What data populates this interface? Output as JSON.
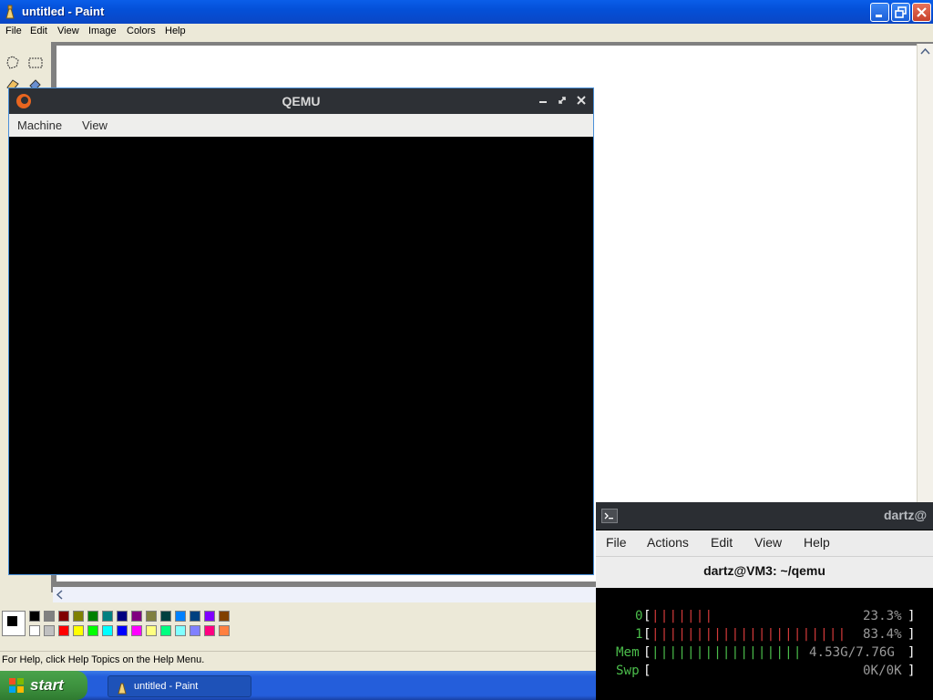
{
  "paint": {
    "title": "untitled - Paint",
    "menu": [
      "File",
      "Edit",
      "View",
      "Image",
      "Colors",
      "Help"
    ],
    "status": "For Help, click Help Topics on the Help Menu.",
    "palette_top": [
      "#000000",
      "#808080",
      "#800000",
      "#808000",
      "#008000",
      "#008080",
      "#000080",
      "#800080",
      "#808040",
      "#004040",
      "#0080ff",
      "#004080",
      "#8000ff",
      "#804000"
    ],
    "palette_bottom": [
      "#ffffff",
      "#c0c0c0",
      "#ff0000",
      "#ffff00",
      "#00ff00",
      "#00ffff",
      "#0000ff",
      "#ff00ff",
      "#ffff80",
      "#00ff80",
      "#80ffff",
      "#8080ff",
      "#ff0080",
      "#ff8040"
    ]
  },
  "taskbar": {
    "start_label": "start",
    "task_label": "untitled - Paint"
  },
  "qemu": {
    "title": "QEMU",
    "menu": [
      "Machine",
      "View"
    ]
  },
  "terminal": {
    "title": "dartz@",
    "menu": [
      "File",
      "Actions",
      "Edit",
      "View",
      "Help"
    ],
    "tab_title": "dartz@VM3: ~/qemu",
    "htop": {
      "cpu0_label": "0",
      "cpu0_bars": "|||||||",
      "cpu0_value": "23.3%",
      "cpu1_label": "1",
      "cpu1_bars": "||||||||||||||||||||||",
      "cpu1_value": "83.4%",
      "mem_label": "Mem",
      "mem_bars": "|||||||||||||||||",
      "mem_value": "4.53G/7.76G",
      "swp_label": "Swp",
      "swp_value": "0K/0K"
    }
  },
  "colors": {
    "xp_blue": "#0a5ee9",
    "qemu_accent": "#4a90d9",
    "htop_green": "#4bbd4b",
    "htop_red": "#d43a3a",
    "htop_blue": "#3a4ed4"
  }
}
